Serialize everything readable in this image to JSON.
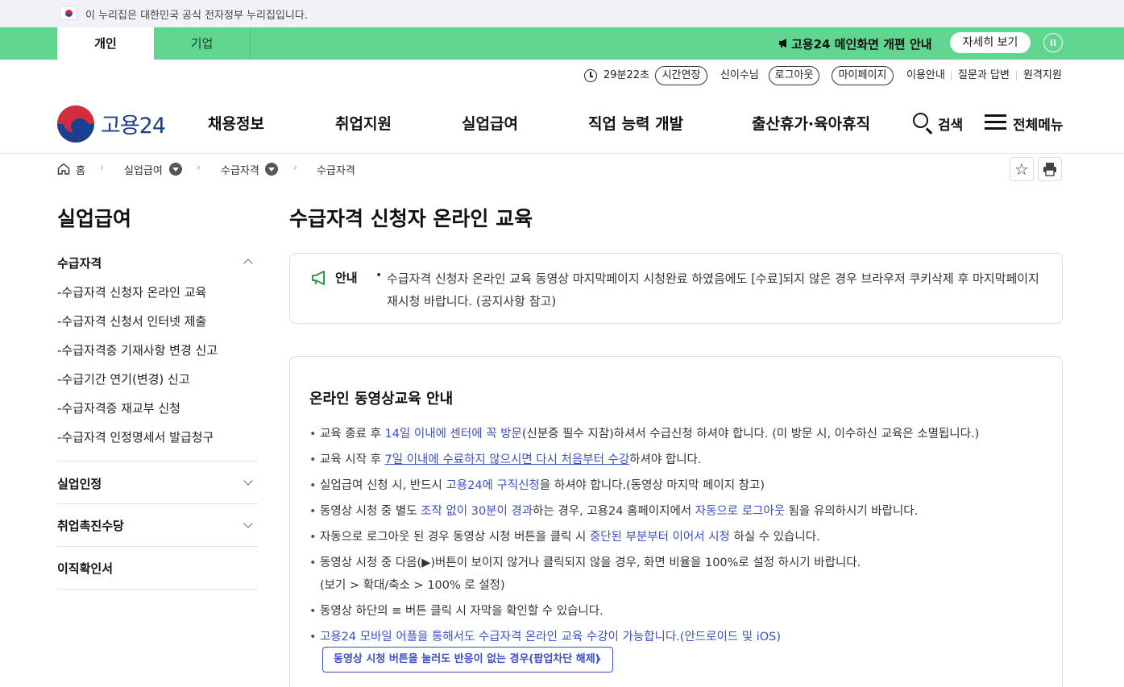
{
  "gov_banner": {
    "text": "이 누리집은 대한민국 공식 전자정부 누리집입니다."
  },
  "top_tabs": {
    "personal": "개인",
    "company": "기업"
  },
  "top_notice": {
    "text": "고용24 메인화면 개편 안내",
    "detail_button": "자세히 보기"
  },
  "util": {
    "timer": "29분22초",
    "extend": "시간연장",
    "user": "신이수님",
    "logout": "로그아웃",
    "mypage": "마이페이지",
    "guide": "이용안내",
    "qna": "질문과 답변",
    "remote": "원격지원"
  },
  "header": {
    "logo": "고용24",
    "nav": [
      "채용정보",
      "취업지원",
      "실업급여",
      "직업 능력 개발",
      "출산휴가·육아휴직"
    ],
    "search": "검색",
    "menu": "전체메뉴"
  },
  "breadcrumb": {
    "home": "홈",
    "level1": "실업급여",
    "level2": "수급자격",
    "current": "수급자격"
  },
  "sidebar": {
    "title": "실업급여",
    "section1": "수급자격",
    "items": [
      "-수급자격 신청자 온라인 교육",
      "-수급자격 신청서 인터넷 제출",
      "-수급자격증 기재사항 변경 신고",
      "-수급기간 연기(변경) 신고",
      "-수급자격증 재교부 신청",
      "-수급자격 인정명세서 발급청구"
    ],
    "section2": "실업인정",
    "section3": "취업촉진수당",
    "section4": "이직확인서"
  },
  "main": {
    "title": "수급자격 신청자 온라인 교육",
    "notice_label": "안내",
    "notice_text": "수급자격 신청자 온라인 교육 동영상 마지막페이지 시청완료 하였음에도 [수료]되지 않은 경우 브라우저 쿠키삭제 후 마지막페이지 재시청 바랍니다. (공지사항 참고)",
    "content_title": "온라인 동영상교육 안내",
    "b1": {
      "a": "교육 종료 후 ",
      "b": "14일 이내에 센터에 꼭 방문",
      "c": "(신분증 필수 지참)하셔서 수급신청 하셔야 합니다. (미 방문 시, 이수하신 교육은 소멸됩니다.)"
    },
    "b2": {
      "a": "교육 시작 후 ",
      "b": "7일 이내에 수료하지 않으시면 다시 처음부터 수강",
      "c": "하셔야 합니다."
    },
    "b3": {
      "a": "실업급여 신청 시, 반드시 ",
      "b": "고용24에 구직신청",
      "c": "을 하셔야 합니다.(동영상 마지막 페이지 참고)"
    },
    "b4": {
      "a": "동영상 시청 중 별도 ",
      "b": "조작 없이 30분이 경과",
      "c": "하는 경우, 고용24 홈페이지에서 ",
      "d": "자동으로 로그아웃",
      "e": " 됨을 유의하시기 바랍니다."
    },
    "b5": {
      "a": "자동으로 로그아웃 된 경우 동영상 시청 버튼을 클릭 시 ",
      "b": "중단된 부분부터 이어서 시청",
      "c": " 하실 수 있습니다."
    },
    "b6": {
      "a": "동영상 시청 중 다음(▶)버튼이 보이지 않거나 클릭되지 않을 경우, 화면 비율을 100%로 설정 하시기 바랍니다.",
      "b": "(보기 > 확대/축소 > 100% 로 설정)"
    },
    "b7": {
      "a": "동영상 하단의 ≡ 버튼 클릭 시 자막을 확인할 수 있습니다."
    },
    "b8": {
      "a": "고용24 모바일 어플을 통해서도 수급자격 온라인 교육 수강이 가능합니다.(안드로이드 및 iOS)"
    },
    "cta": "동영상 시청 버튼을 눌러도 반응이 없는 경우(팝업차단 해제)"
  }
}
